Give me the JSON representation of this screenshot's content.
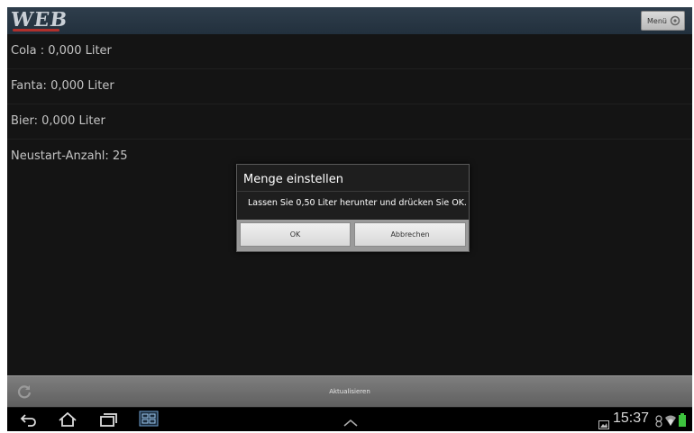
{
  "header": {
    "logo_text": "WEB",
    "menu_label": "Menü",
    "menu_icon": "gear-icon"
  },
  "list": {
    "items": [
      {
        "label": "Cola : 0,000 Liter"
      },
      {
        "label": "Fanta:  0,000 Liter"
      },
      {
        "label": "Bier:  0,000 Liter"
      },
      {
        "label": "Neustart-Anzahl: 25"
      }
    ]
  },
  "dialog": {
    "title": "Menge einstellen",
    "message": "Lassen Sie 0,50 Liter herunter und drücken Sie OK.",
    "ok_label": "OK",
    "cancel_label": "Abbrechen"
  },
  "refresh_bar": {
    "label": "Aktualisieren",
    "icon": "refresh-icon"
  },
  "system_bar": {
    "time": "15:37",
    "icons": [
      "back-icon",
      "home-icon",
      "recent-apps-icon",
      "screenshot-icon",
      "up-chevron-icon",
      "image-notification-icon",
      "usb-icon",
      "wifi-icon",
      "battery-icon"
    ]
  },
  "colors": {
    "background": "#141414",
    "header": "#2a3845",
    "text": "#c4c4c4",
    "dialog_bg": "#1e1e1e",
    "battery": "#3ec33e"
  }
}
